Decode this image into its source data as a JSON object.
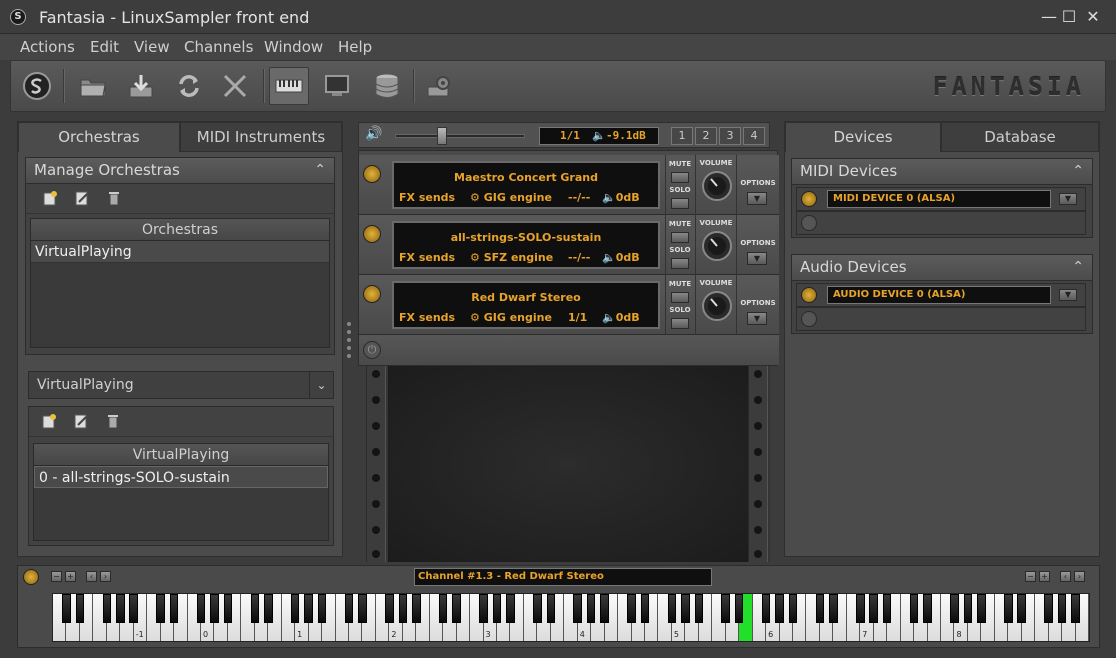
{
  "window": {
    "title": "Fantasia - LinuxSampler front end",
    "app_icon_glyph": "S",
    "minimize_glyph": "—",
    "maximize_glyph": "☐",
    "close_glyph": "✕"
  },
  "menu": [
    "Actions",
    "Edit",
    "View",
    "Channels",
    "Window",
    "Help"
  ],
  "toolbar": {
    "buttons": [
      "logo-icon",
      "open-folder-icon",
      "save-icon",
      "refresh-icon",
      "tools-icon",
      "keyboard-icon",
      "monitor-icon",
      "database-icon",
      "config-icon"
    ],
    "active_button": "keyboard-icon",
    "brand": "FANTASIA"
  },
  "left_panel": {
    "tabs": [
      "Orchestras",
      "MIDI Instruments"
    ],
    "active_tab": "Orchestras",
    "manage_title": "Manage Orchestras",
    "collapse_glyph": "⌃",
    "orchestras_header": "Orchestras",
    "orchestras": [
      "VirtualPlaying"
    ],
    "selected_orchestra": "VirtualPlaying",
    "dropdown_arrow": "⌄",
    "instruments_header": "VirtualPlaying",
    "instruments": [
      "0 - all-strings-SOLO-sustain"
    ]
  },
  "rack_header": {
    "volume_glyph": "🔊",
    "master_ratio": "1/1",
    "master_volume": "-9.1dB",
    "master_volume_glyph": "🔈",
    "master_slider_level": 0.35,
    "pages": [
      "1",
      "2",
      "3",
      "4"
    ]
  },
  "channels": [
    {
      "name": "Maestro Concert Grand",
      "fx": "FX sends",
      "engine": "GIG engine",
      "voices": "--/--",
      "volume": "0dB"
    },
    {
      "name": "all-strings-SOLO-sustain",
      "fx": "FX sends",
      "engine": "SFZ engine",
      "voices": "--/--",
      "volume": "0dB"
    },
    {
      "name": "Red Dwarf Stereo",
      "fx": "FX sends",
      "engine": "GIG engine",
      "voices": "1/1",
      "volume": "0dB"
    }
  ],
  "strip_labels": {
    "mute": "MUTE",
    "solo": "SOLO",
    "volume": "VOLUME",
    "options": "OPTIONS",
    "option_glyph": "▼",
    "engine_glyph": "⚙",
    "volume_glyph": "🔈",
    "power_glyph": "⏻"
  },
  "right_panel": {
    "tabs": [
      "Devices",
      "Database"
    ],
    "active_tab": "Devices",
    "midi_title": "MIDI Devices",
    "midi_devices": [
      "MIDI DEVICE 0 (ALSA)"
    ],
    "audio_title": "Audio Devices",
    "audio_devices": [
      "AUDIO DEVICE 0 (ALSA)"
    ],
    "collapse_glyph": "⌃",
    "option_glyph": "▼",
    "power_glyph": "⏻"
  },
  "keyboard": {
    "channel_display": "Channel #1.3 - Red Dwarf Stereo",
    "minus": "−",
    "plus": "+",
    "left": "‹",
    "right": "›",
    "octave_labels": [
      "-1",
      "0",
      "1",
      "2",
      "3",
      "4",
      "5",
      "6",
      "7",
      "8"
    ],
    "pressed_white_key_index": 51
  },
  "colors": {
    "lcd_text": "#e8a32a",
    "pressed_key": "#22e02a"
  }
}
